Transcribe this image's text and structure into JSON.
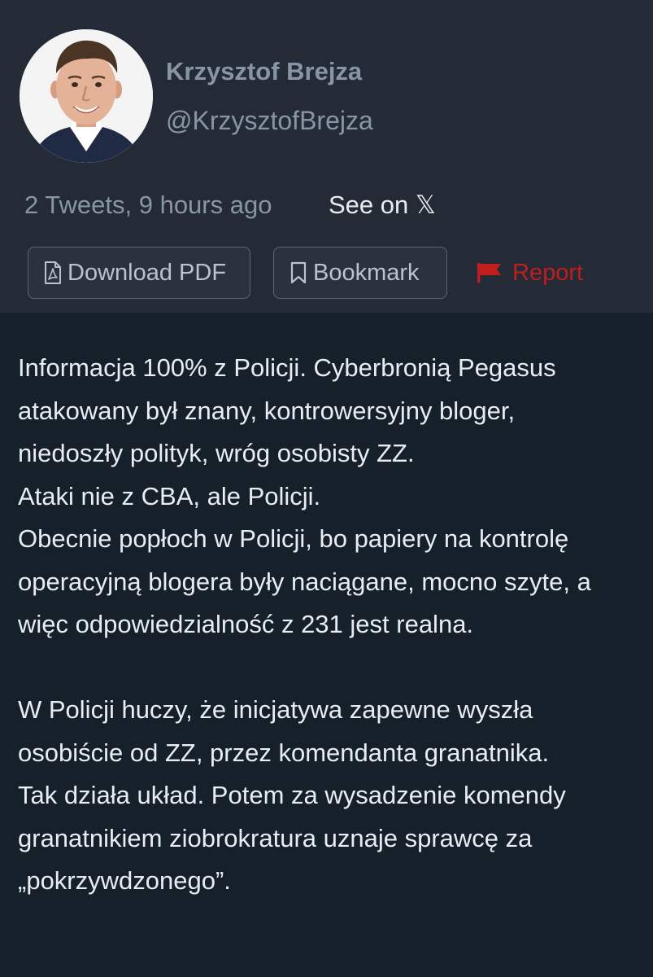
{
  "author": {
    "name": "Krzysztof Brejza",
    "handle": "@KrzysztofBrejza"
  },
  "meta": {
    "summary": "2 Tweets, 9 hours ago",
    "see_on": "See on 𝕏"
  },
  "actions": {
    "download_pdf": "Download PDF",
    "bookmark": "Bookmark",
    "report": "Report"
  },
  "icons": {
    "pdf": "pdf-file-icon",
    "bookmark": "bookmark-icon",
    "report": "flag-icon"
  },
  "colors": {
    "page_background": "#15202b",
    "header_background": "#252b36",
    "muted_text": "#8796a6",
    "body_text": "#e9edf2",
    "report_red": "#c01d1d"
  },
  "tweet": {
    "lines": [
      "Informacja 100% z Policji. Cyberbronią Pegasus",
      "atakowany był znany, kontrowersyjny bloger,",
      "niedoszły polityk, wróg osobisty ZZ.",
      "Ataki nie z CBA, ale Policji.",
      "Obecnie popłoch w Policji, bo papiery na kontrolę",
      "operacyjną blogera były naciągane, mocno szyte, a",
      "więc odpowiedzialność z 231 jest realna.",
      "",
      "W Policji huczy, że inicjatywa zapewne wyszła",
      "osobiście od ZZ, przez komendanta granatnika.",
      "Tak działa układ. Potem za wysadzenie komendy",
      "granatnikiem ziobrokratura uznaje sprawcę za",
      "„pokrzywdzonego”."
    ]
  }
}
